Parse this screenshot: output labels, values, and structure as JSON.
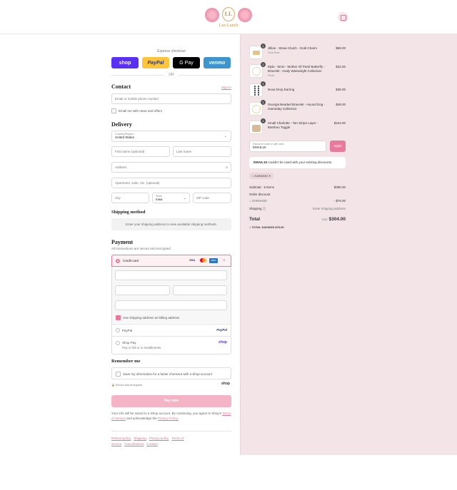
{
  "store": {
    "name": "Lux Lunch",
    "monogram": "LL"
  },
  "express": {
    "label": "Express checkout",
    "shop": "shop",
    "paypal": "PayPal",
    "gpay": "G Pay",
    "venmo": "venmo",
    "or": "OR"
  },
  "contact": {
    "heading": "Contact",
    "sign_in": "Sign in",
    "email_placeholder": "Email or mobile phone number",
    "news_label": "Email me with news and offers"
  },
  "delivery": {
    "heading": "Delivery",
    "country_label": "Country/Region",
    "country_value": "United States",
    "first_name": "First name (optional)",
    "last_name": "Last name",
    "address": "Address",
    "apartment": "Apartment, suite, etc. (optional)",
    "city": "City",
    "state_label": "State",
    "state_value": "Iowa",
    "zip": "ZIP code"
  },
  "shipping": {
    "heading": "Shipping method",
    "note": "Enter your shipping address to view available shipping methods."
  },
  "payment": {
    "heading": "Payment",
    "subtitle": "All transactions are secure and encrypted.",
    "credit_card": "Credit card",
    "card_brands": [
      "VISA",
      "MC",
      "AMEX",
      "+3"
    ],
    "billing_label": "Use shipping address as billing address",
    "paypal": "PayPal",
    "paypal_logo": "PayPal",
    "shoppay": "Shop Pay",
    "shoppay_sub": "Pay in full or in installments",
    "shoppay_logo": "shop"
  },
  "remember": {
    "heading": "Remember me",
    "save_label": "Save my information for a faster checkout with a Shop account",
    "secure": "Secure and encrypted",
    "shop_logo": "shop"
  },
  "pay_button": "Pay now",
  "disclaimer": {
    "text": "Your info will be saved to a Shop account. By continuing, you agree to Shop's",
    "terms": "Terms of Service",
    "and": "and acknowledge the",
    "privacy": "Privacy Policy."
  },
  "footer_links": [
    "Refund policy",
    "Shipping",
    "Privacy policy",
    "Terms of service",
    "Cancellations",
    "Contact"
  ],
  "cart": {
    "items": [
      {
        "name": "Jillian - Straw Clutch - Gold Charm",
        "variant": "Gold Bow",
        "qty": "1",
        "price": "$98.00"
      },
      {
        "name": "Myla - 6mm - Mother Of Pearl Butterfly - Bracelet - Avaly Wainwright Collection",
        "variant": "Pearl",
        "qty": "1",
        "price": "$32.00"
      },
      {
        "name": "Nova Drop Earring",
        "variant": "",
        "qty": "1",
        "price": "$38.00"
      },
      {
        "name": "Georgia Beaded Bracelet - Hound Dog - Gameday Collection",
        "variant": "",
        "qty": "1",
        "price": "$48.00"
      },
      {
        "name": "Small Charlotte - Tan Stripe Layer - Bamboo Toggle",
        "variant": "",
        "qty": "1",
        "price": "$164.00"
      }
    ],
    "discount_label": "Discount code or gift card",
    "discount_value": "EMAIL15",
    "apply": "Apply",
    "error_code": "EMAIL15",
    "error_text": "couldn't be used with your existing discounts.",
    "tag": "SARAH20",
    "subtotal_label": "Subtotal · 5 items",
    "subtotal": "$380.00",
    "order_discount_label": "Order discount",
    "discount_code": "SARAH20",
    "discount_amount": "- $76.00",
    "shipping_label": "Shipping",
    "shipping_value": "Enter shipping address",
    "total_label": "Total",
    "currency": "USD",
    "total": "$304.00",
    "savings_label": "TOTAL SAVINGS",
    "savings": "$76.00"
  },
  "colors": {
    "accent": "#e87a9d",
    "panel": "#f3e4e8",
    "paypal": "#ffc439",
    "shop": "#5a31f4",
    "venmo": "#3d95ce"
  }
}
